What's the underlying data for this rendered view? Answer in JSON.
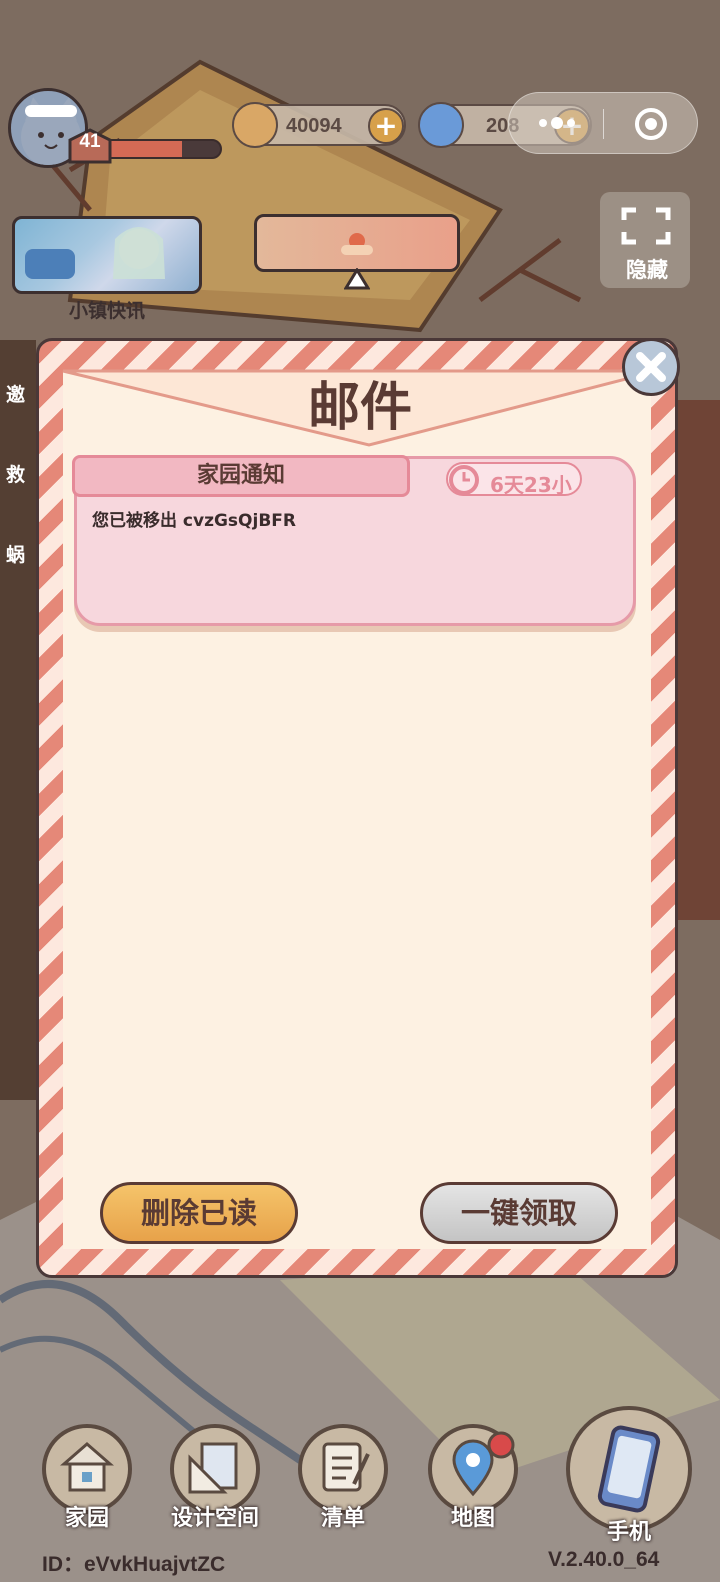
{
  "hud": {
    "level": "41",
    "xp_fraction": 0.68,
    "coins": "40094",
    "gems": "208",
    "news_label": "小镇快讯",
    "hide_label": "隐藏"
  },
  "side_menu": [
    "邀",
    "救",
    "蜗"
  ],
  "mail": {
    "title": "邮件",
    "items": [
      {
        "category": "家园通知",
        "timer": "6天23小",
        "body": "您已被移出 cvzGsQjBFR"
      }
    ],
    "delete_read_label": "删除已读",
    "claim_all_label": "一键领取"
  },
  "nav": {
    "home": "家园",
    "design": "设计空间",
    "list": "清单",
    "map": "地图",
    "phone": "手机"
  },
  "footer": {
    "id": "ID：eVvkHuajvtZC",
    "version": "V.2.40.0_64"
  },
  "colors": {
    "dialog_stripe": "#e58878",
    "dialog_bg": "#fdf1e2",
    "card_bg": "#f7d7dd",
    "accent_pink": "#e58a98",
    "title_brown": "#5a3b34",
    "delete_button": "#f5c46a",
    "claim_button": "#d6d6d6"
  }
}
